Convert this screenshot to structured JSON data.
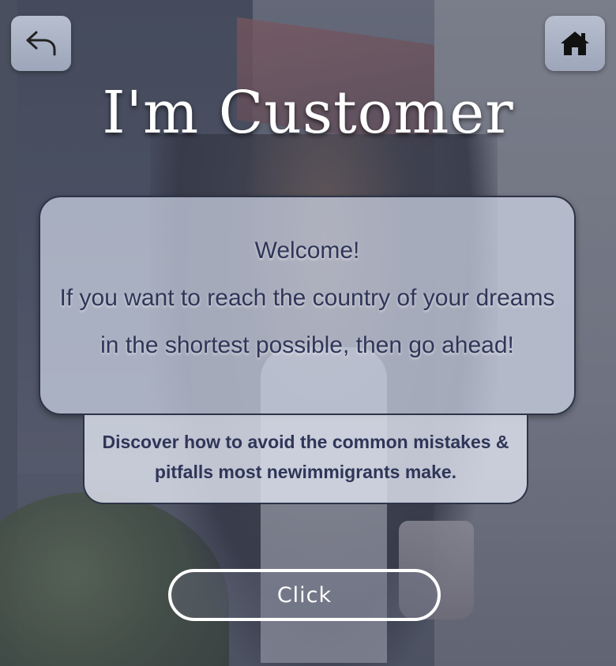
{
  "header": {
    "back_icon": "undo-arrow-icon",
    "home_icon": "home-icon",
    "title": "I'm Customer"
  },
  "welcome": {
    "line1": "Welcome!",
    "line2": "If you want to reach the country of your dreams",
    "line3": "in the shortest possible, then go ahead!"
  },
  "tip": {
    "text": "Discover how to avoid the common mistakes & pitfalls most newimmigrants make."
  },
  "cta": {
    "label": "Click"
  },
  "colors": {
    "card_text": "#2f3658",
    "title": "#ffffff",
    "button_border": "#ffffff",
    "icon_button_bg": "#a9b1c4"
  }
}
